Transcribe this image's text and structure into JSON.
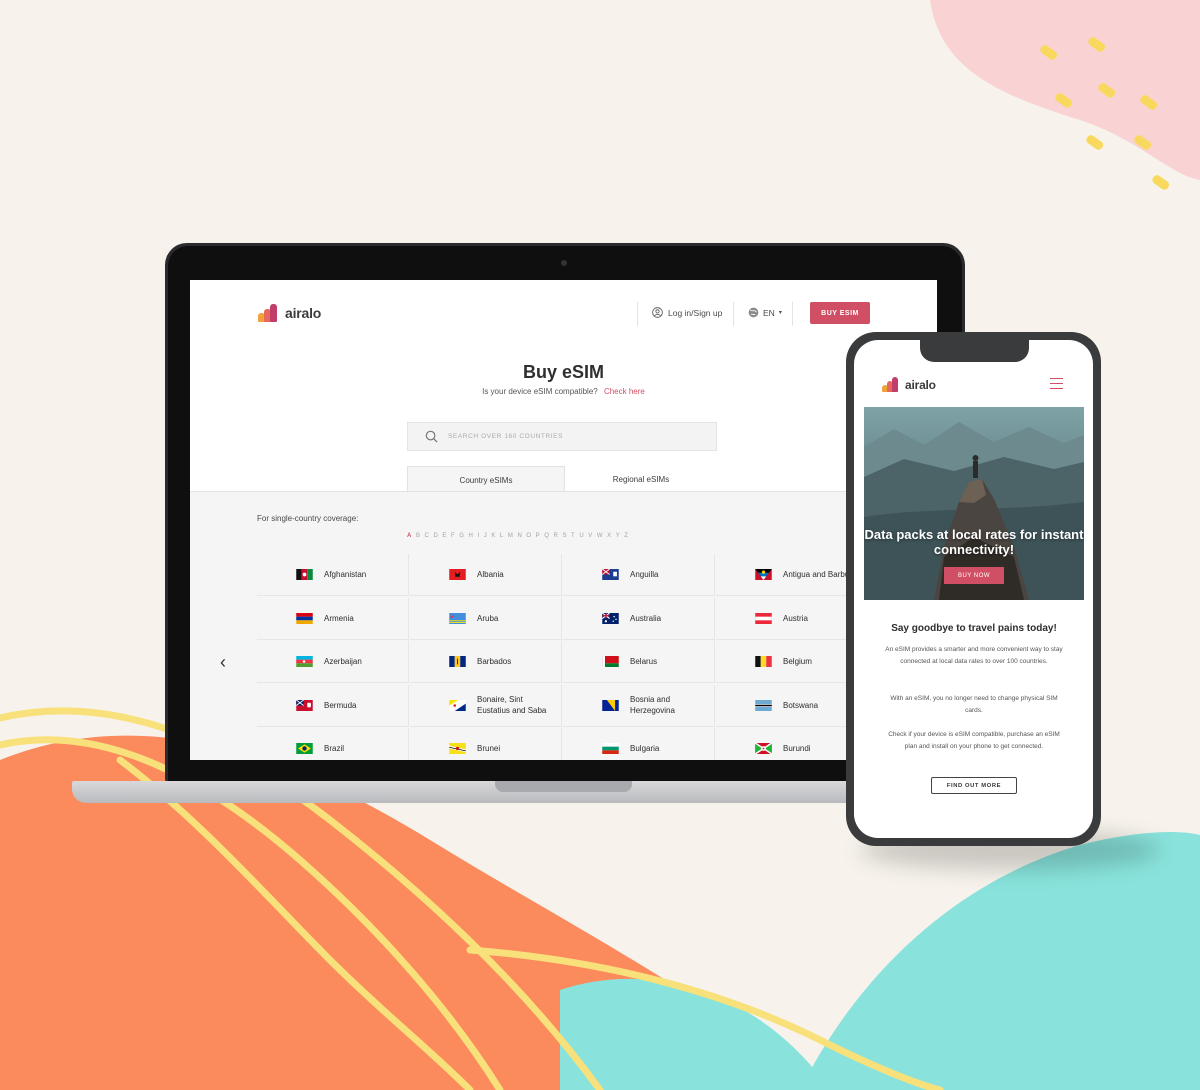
{
  "brand": {
    "name": "airalo",
    "colors": {
      "accent": "#d14f64",
      "logo_bars": [
        "#f0a33a",
        "#e6675b",
        "#c13e6a"
      ]
    }
  },
  "desktop": {
    "nav": {
      "login_label": "Log in/Sign up",
      "lang_label": "EN",
      "buy_button": "BUY ESIM"
    },
    "title": "Buy eSIM",
    "compat_text": "Is your device eSIM compatible?",
    "compat_link": "Check here",
    "search": {
      "placeholder": "SEARCH OVER 160 COUNTRIES"
    },
    "tabs": [
      {
        "label": "Country eSIMs",
        "active": true
      },
      {
        "label": "Regional eSIMs",
        "active": false
      }
    ],
    "coverage_label": "For single-country coverage:",
    "alphabet": [
      "A",
      "B",
      "C",
      "D",
      "E",
      "F",
      "G",
      "H",
      "I",
      "J",
      "K",
      "L",
      "M",
      "N",
      "O",
      "P",
      "Q",
      "R",
      "S",
      "T",
      "U",
      "V",
      "W",
      "X",
      "Y",
      "Z"
    ],
    "active_letter": "A",
    "countries": [
      {
        "name": "Afghanistan",
        "flag": "afghanistan-flag-icon"
      },
      {
        "name": "Albania",
        "flag": "albania-flag-icon"
      },
      {
        "name": "Anguilla",
        "flag": "anguilla-flag-icon"
      },
      {
        "name": "Antigua and Barbuda",
        "flag": "antigua-flag-icon"
      },
      {
        "name": "Armenia",
        "flag": "armenia-flag-icon"
      },
      {
        "name": "Aruba",
        "flag": "aruba-flag-icon"
      },
      {
        "name": "Australia",
        "flag": "australia-flag-icon"
      },
      {
        "name": "Austria",
        "flag": "austria-flag-icon"
      },
      {
        "name": "Azerbaijan",
        "flag": "azerbaijan-flag-icon"
      },
      {
        "name": "Barbados",
        "flag": "barbados-flag-icon"
      },
      {
        "name": "Belarus",
        "flag": "belarus-flag-icon"
      },
      {
        "name": "Belgium",
        "flag": "belgium-flag-icon"
      },
      {
        "name": "Bermuda",
        "flag": "bermuda-flag-icon"
      },
      {
        "name": "Bonaire, Sint Eustatius and Saba",
        "flag": "bonaire-flag-icon"
      },
      {
        "name": "Bosnia and Herzegovina",
        "flag": "bosnia-flag-icon"
      },
      {
        "name": "Botswana",
        "flag": "botswana-flag-icon"
      },
      {
        "name": "Brazil",
        "flag": "brazil-flag-icon"
      },
      {
        "name": "Brunei",
        "flag": "brunei-flag-icon"
      },
      {
        "name": "Bulgaria",
        "flag": "bulgaria-flag-icon"
      },
      {
        "name": "Burundi",
        "flag": "burundi-flag-icon"
      }
    ]
  },
  "mobile": {
    "hero_title": "Data packs at local rates for instant connectivity!",
    "hero_button": "BUY NOW",
    "section_title": "Say goodbye to travel pains today!",
    "paragraphs": [
      "An eSIM provides a smarter and more convenient way to stay connected at local data rates to over 100 countries.",
      "With an eSIM, you no longer need to change physical SIM cards.",
      "Check if your device is eSIM compatible, purchase an eSIM plan and install on your phone to get connected."
    ],
    "find_out_button": "FIND OUT MORE"
  }
}
